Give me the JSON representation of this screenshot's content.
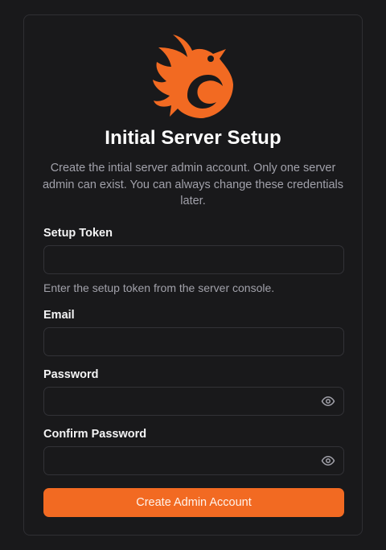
{
  "setup": {
    "title": "Initial Server Setup",
    "subtitle": "Create the intial server admin account. Only one server admin can exist. You can always change these credentials later.",
    "accent_color": "#f26a22",
    "logo_icon": "flame-bird-logo",
    "token": {
      "label": "Setup Token",
      "value": "",
      "placeholder": "",
      "hint": "Enter the setup token from the server console."
    },
    "email": {
      "label": "Email",
      "value": "",
      "placeholder": ""
    },
    "password": {
      "label": "Password",
      "value": "",
      "placeholder": "",
      "toggle_icon": "eye-icon"
    },
    "confirm_password": {
      "label": "Confirm Password",
      "value": "",
      "placeholder": "",
      "toggle_icon": "eye-icon"
    },
    "submit_label": "Create Admin Account"
  }
}
